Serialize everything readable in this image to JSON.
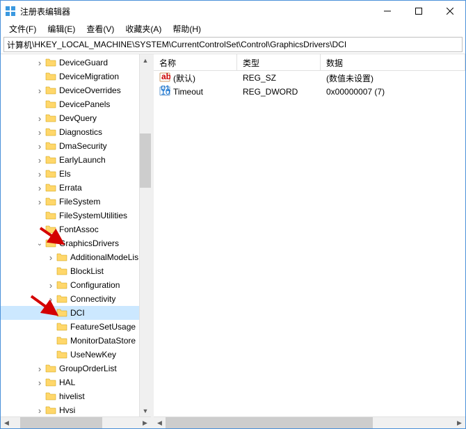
{
  "window": {
    "title": "注册表编辑器"
  },
  "menu": {
    "file": "文件(F)",
    "edit": "编辑(E)",
    "view": "查看(V)",
    "favorites": "收藏夹(A)",
    "help": "帮助(H)"
  },
  "address": {
    "prefix": "计算机",
    "path": "\\HKEY_LOCAL_MACHINE\\SYSTEM\\CurrentControlSet\\Control\\GraphicsDrivers\\DCI"
  },
  "tree": [
    {
      "indent": 3,
      "caret": "closed",
      "label": "DeviceGuard"
    },
    {
      "indent": 3,
      "caret": "none",
      "label": "DeviceMigration"
    },
    {
      "indent": 3,
      "caret": "closed",
      "label": "DeviceOverrides"
    },
    {
      "indent": 3,
      "caret": "none",
      "label": "DevicePanels"
    },
    {
      "indent": 3,
      "caret": "closed",
      "label": "DevQuery"
    },
    {
      "indent": 3,
      "caret": "closed",
      "label": "Diagnostics"
    },
    {
      "indent": 3,
      "caret": "closed",
      "label": "DmaSecurity"
    },
    {
      "indent": 3,
      "caret": "closed",
      "label": "EarlyLaunch"
    },
    {
      "indent": 3,
      "caret": "closed",
      "label": "Els"
    },
    {
      "indent": 3,
      "caret": "closed",
      "label": "Errata"
    },
    {
      "indent": 3,
      "caret": "closed",
      "label": "FileSystem"
    },
    {
      "indent": 3,
      "caret": "none",
      "label": "FileSystemUtilities"
    },
    {
      "indent": 3,
      "caret": "none",
      "label": "FontAssoc"
    },
    {
      "indent": 3,
      "caret": "open",
      "label": "GraphicsDrivers"
    },
    {
      "indent": 4,
      "caret": "closed",
      "label": "AdditionalModeLis"
    },
    {
      "indent": 4,
      "caret": "none",
      "label": "BlockList"
    },
    {
      "indent": 4,
      "caret": "closed",
      "label": "Configuration"
    },
    {
      "indent": 4,
      "caret": "closed",
      "label": "Connectivity"
    },
    {
      "indent": 4,
      "caret": "none",
      "label": "DCI",
      "selected": true
    },
    {
      "indent": 4,
      "caret": "none",
      "label": "FeatureSetUsage"
    },
    {
      "indent": 4,
      "caret": "none",
      "label": "MonitorDataStore"
    },
    {
      "indent": 4,
      "caret": "none",
      "label": "UseNewKey"
    },
    {
      "indent": 3,
      "caret": "closed",
      "label": "GroupOrderList"
    },
    {
      "indent": 3,
      "caret": "closed",
      "label": "HAL"
    },
    {
      "indent": 3,
      "caret": "none",
      "label": "hivelist"
    },
    {
      "indent": 3,
      "caret": "closed",
      "label": "Hvsi"
    }
  ],
  "list": {
    "header": {
      "name": "名称",
      "type": "类型",
      "data": "数据"
    },
    "rows": [
      {
        "icon": "string-value-icon",
        "name": "(默认)",
        "type": "REG_SZ",
        "data": "(数值未设置)"
      },
      {
        "icon": "dword-value-icon",
        "name": "Timeout",
        "type": "REG_DWORD",
        "data": "0x00000007 (7)"
      }
    ]
  }
}
